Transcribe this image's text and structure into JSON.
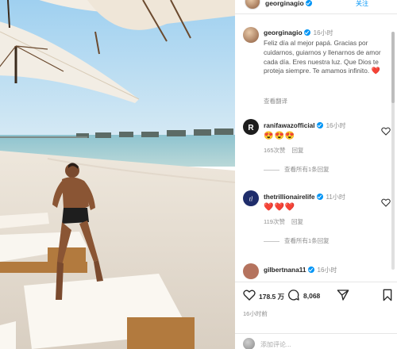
{
  "header": {
    "username": "georginagio",
    "follow_label": "关注"
  },
  "caption": {
    "username": "georginagio",
    "time": "16小时",
    "text": "Feliz día al mejor papá. Gracias por cuidarnos, guiarnos y llenarnos de amor cada día. Eres nuestra luz. Que Dios te proteja siempre. Te amamos infinito.",
    "heart": "❤️",
    "translate_label": "查看翻译"
  },
  "comments": [
    {
      "username": "ranifawazofficial",
      "time": "16小时",
      "emoji": "😍😍😍",
      "likes": "165次赞",
      "reply_label": "回复",
      "replies_label": "查看所有1条回复",
      "avatar_color": "#1d1d1d"
    },
    {
      "username": "thetrillionairelife",
      "time": "11小时",
      "emoji": "❤️❤️❤️",
      "likes": "119次赞",
      "reply_label": "回复",
      "replies_label": "查看所有1条回复",
      "avatar_color": "#1f2d6b"
    },
    {
      "username": "gilbertnana11",
      "time": "16小时",
      "avatar_color": "#b5735e"
    }
  ],
  "actions": {
    "likes": "178.5 万",
    "comments": "8,068",
    "time": "16小时前"
  },
  "add_comment": {
    "placeholder": "添加评论..."
  },
  "colors": {
    "accent": "#0095f6",
    "heart": "#ed1c45",
    "muted": "#8e8e8e"
  }
}
